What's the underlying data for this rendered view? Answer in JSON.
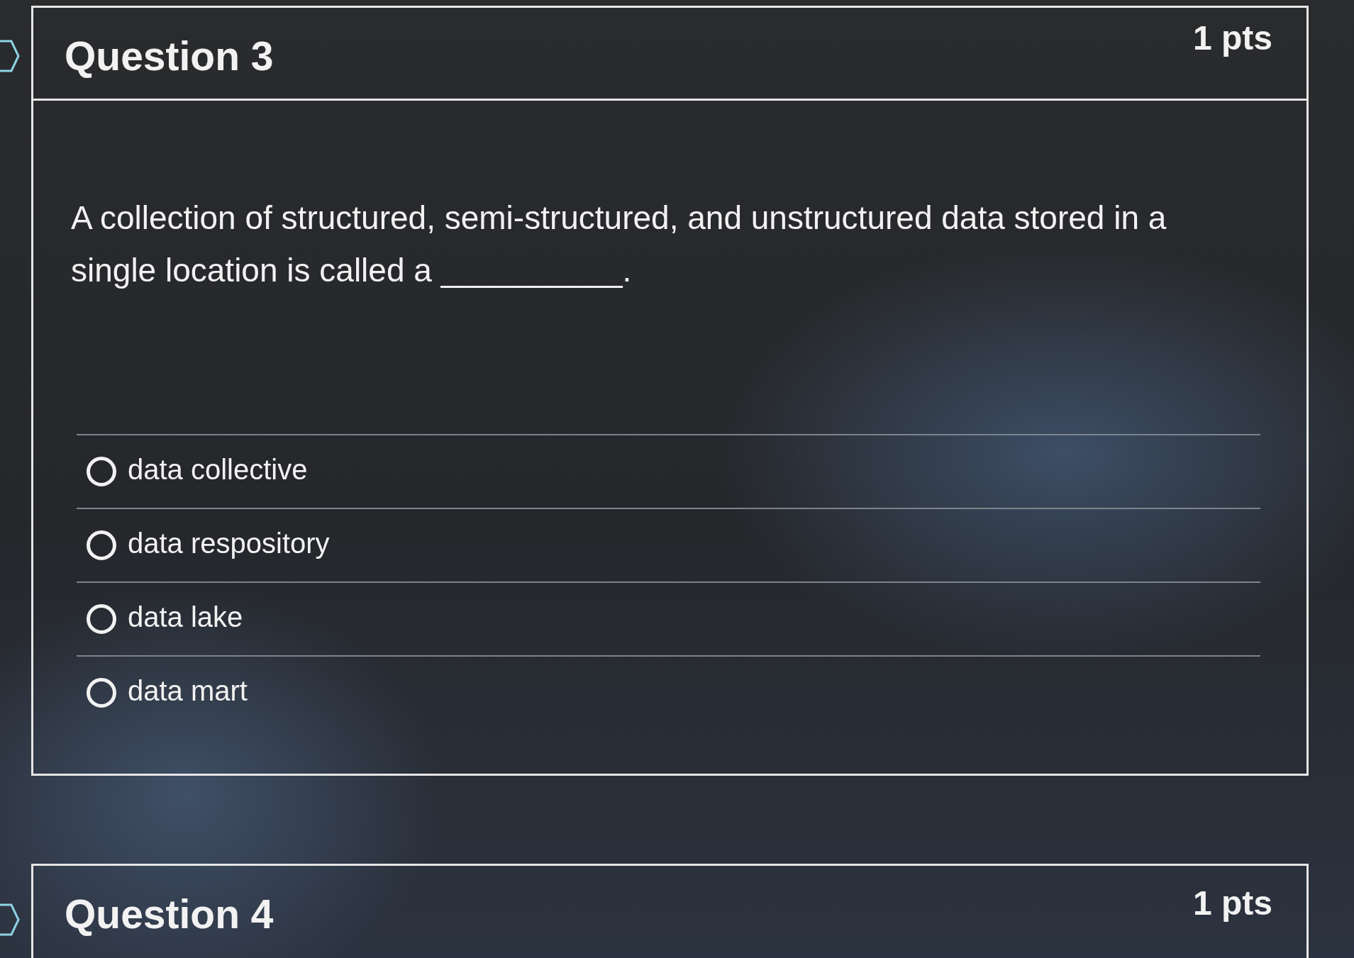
{
  "questions": [
    {
      "title": "Question 3",
      "points": "1 pts",
      "prompt": "A collection of structured, semi-structured, and unstructured data stored in a single location is called a __________.",
      "answers": [
        {
          "label": "data collective",
          "selected": false
        },
        {
          "label": "data respository",
          "selected": false
        },
        {
          "label": "data lake",
          "selected": false
        },
        {
          "label": "data mart",
          "selected": false
        }
      ]
    },
    {
      "title": "Question 4",
      "points": "1 pts"
    }
  ]
}
